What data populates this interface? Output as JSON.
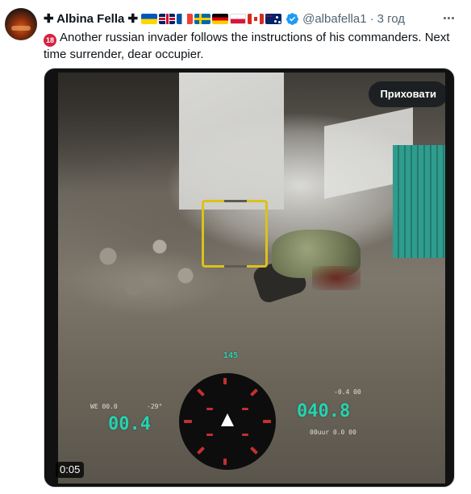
{
  "tweet": {
    "display_name": "✚ Albina Fella ✚",
    "flags": [
      "UA",
      "GB",
      "FR",
      "SE",
      "DE",
      "PL",
      "CA",
      "AU"
    ],
    "verified_icon": "verified-badge-icon",
    "handle": "@albafella1",
    "separator": "·",
    "time": "3 год",
    "age_badge": "18",
    "text": "Another russian invader follows the instructions of his commanders. Next time surrender, dear occupier."
  },
  "media": {
    "hide_label": "Приховати",
    "duration": "0:05",
    "hud": {
      "left_big": "00.4",
      "left_small": "WE 00.0",
      "angle": "-29°",
      "right_big": "040.8",
      "right_small": "-0.4 00",
      "bottom_right": "00uur 0.0 00",
      "heading": "145"
    }
  },
  "colors": {
    "brand_text": "#0f1419",
    "secondary_text": "#536471",
    "verified": "#1d9bf0",
    "hud_teal": "#25d3b1",
    "target_yellow": "#d9c21a"
  }
}
